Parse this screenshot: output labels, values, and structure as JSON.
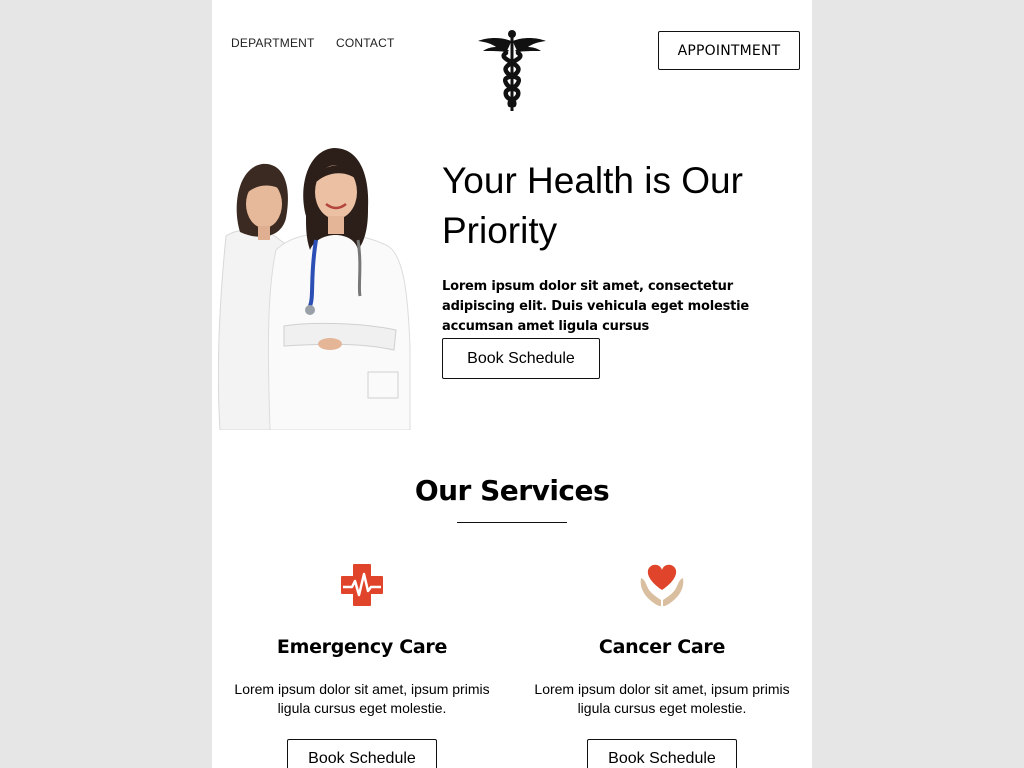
{
  "header": {
    "nav": [
      {
        "label": "DEPARTMENT"
      },
      {
        "label": "CONTACT"
      }
    ],
    "appointment_label": "APPOINTMENT",
    "logo_icon": "caduceus-icon"
  },
  "hero": {
    "title": "Your Health is Our Priority",
    "text": "Lorem ipsum dolor sit amet, consectetur adipiscing elit. Duis vehicula eget molestie accumsan amet ligula cursus",
    "button_label": "Book Schedule",
    "image": "two-doctors-photo"
  },
  "services": {
    "title": "Our Services",
    "items": [
      {
        "icon": "medical-cross-heartbeat-icon",
        "title": "Emergency Care",
        "text": "Lorem ipsum dolor sit amet, ipsum primis ligula cursus eget molestie.",
        "button_label": "Book Schedule"
      },
      {
        "icon": "heart-in-hands-icon",
        "title": "Cancer Care",
        "text": "Lorem ipsum dolor sit amet, ipsum primis ligula cursus eget molestie.",
        "button_label": "Book Schedule"
      }
    ]
  },
  "colors": {
    "page_bg": "#e6e6e6",
    "content_bg": "#ffffff",
    "accent_red": "#e0442a",
    "hands_beige": "#d9bfa0"
  }
}
